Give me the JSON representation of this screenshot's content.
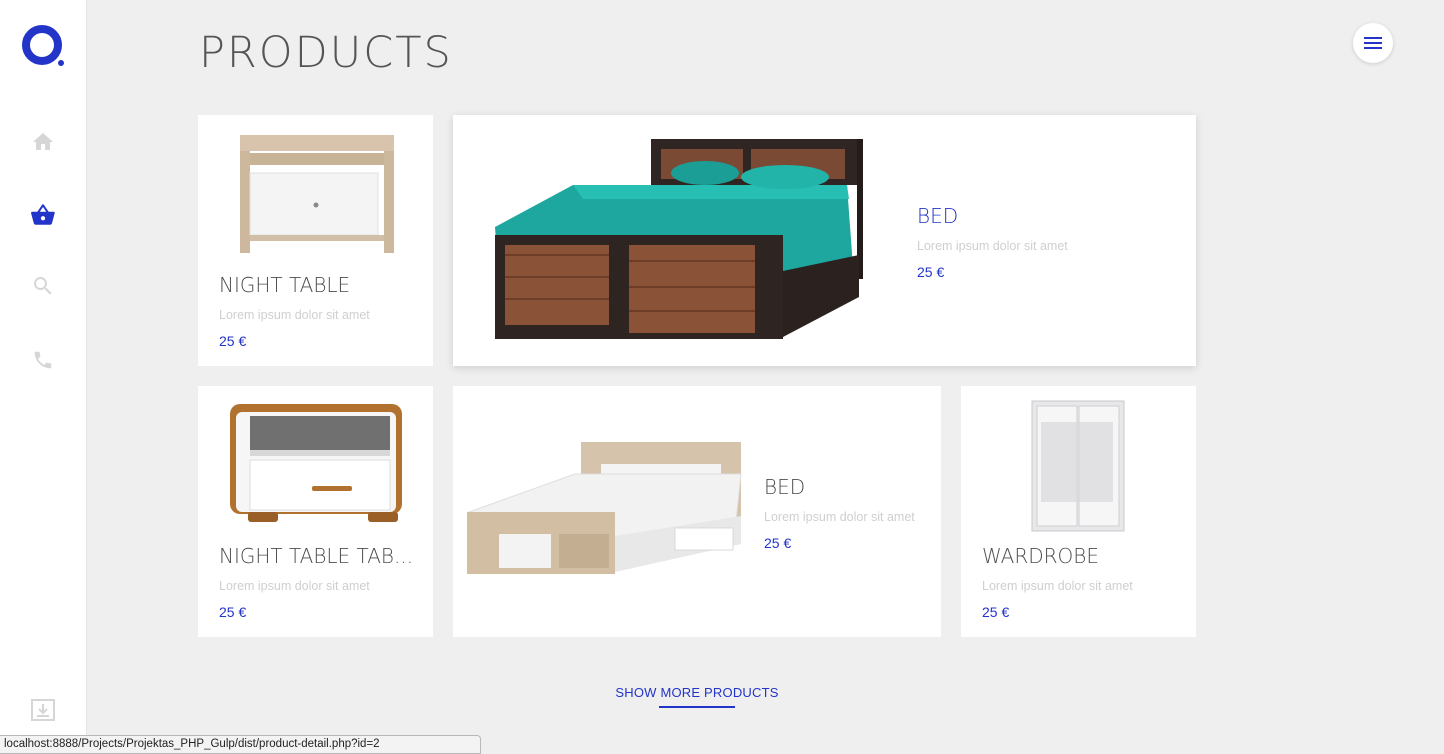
{
  "page": {
    "title": "PRODUCTS",
    "show_more_label": "SHOW MORE PRODUCTS",
    "status_url": "localhost:8888/Projects/Projektas_PHP_Gulp/dist/product-detail.php?id=2"
  },
  "sidebar": {
    "items": [
      {
        "icon": "home-icon",
        "active": false
      },
      {
        "icon": "shopping-basket-icon",
        "active": true
      },
      {
        "icon": "search-icon",
        "active": false
      },
      {
        "icon": "phone-icon",
        "active": false
      }
    ],
    "bottom_icon": "download-icon"
  },
  "header": {
    "menu_icon": "hamburger-menu-icon"
  },
  "colors": {
    "accent": "#2334c8",
    "inactive_icon": "#d6d6d6",
    "background": "#efefef"
  },
  "products": [
    {
      "name": "NIGHT TABLE",
      "desc": "Lorem ipsum dolor sit amet",
      "price": "25 €"
    },
    {
      "name": "BED",
      "desc": "Lorem ipsum dolor sit amet",
      "price": "25 €"
    },
    {
      "name": "NIGHT TABLE TAB...",
      "desc": "Lorem ipsum dolor sit amet",
      "price": "25 €"
    },
    {
      "name": "BED",
      "desc": "Lorem ipsum dolor sit amet",
      "price": "25 €"
    },
    {
      "name": "WARDROBE",
      "desc": "Lorem ipsum dolor sit amet",
      "price": "25 €"
    }
  ]
}
